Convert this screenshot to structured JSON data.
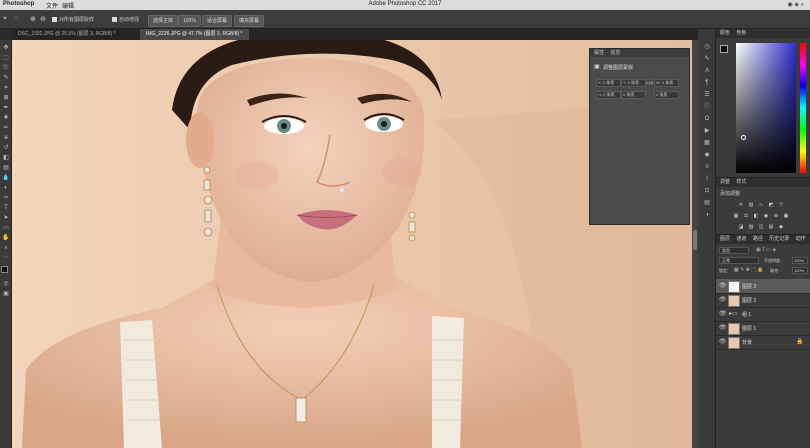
{
  "app": {
    "title": "Adobe Photoshop CC 2017",
    "menu_app": "Photoshop",
    "menu_file": "文件",
    "menu_edit": "编辑"
  },
  "options": {
    "sample_all_layers": "对所有图层取样",
    "auto_enhance": "自动增强",
    "select_subject": "选择主体",
    "select_and_mask": "选择并遮住...",
    "zoom": "100%",
    "fit_screen": "适合屏幕",
    "fill_screen": "填充屏幕"
  },
  "tabs": [
    {
      "label": "DSC_1592.JPG @ 25.5% (图层 3, RGB/8) *"
    },
    {
      "label": "IMG_2226.JPG @ 47.7% (图层 3, RGB/8) *"
    }
  ],
  "properties": {
    "tabs": [
      "属性",
      "信息"
    ],
    "title": "调整图层蒙版",
    "fields": [
      "X: 0 像素",
      "Y: 0 像素",
      "W: 0 像素",
      "H: 0 像素",
      "0 像素",
      "0 像素"
    ],
    "link": "GO"
  },
  "color_panel": {
    "tabs": [
      "颜色",
      "色板"
    ]
  },
  "adjustments": {
    "tabs": [
      "调整",
      "样式"
    ],
    "hint": "添加调整"
  },
  "layers": {
    "tabs": [
      "图层",
      "通道",
      "路径",
      "历史记录",
      "动作"
    ],
    "kind": "类型",
    "blend_mode": "正常",
    "opacity_label": "不透明度:",
    "opacity_value": "100%",
    "lock_label": "锁定:",
    "fill_label": "填充:",
    "fill_value": "100%",
    "items": [
      {
        "name": "图层 3"
      },
      {
        "name": "图层 2"
      },
      {
        "name": "组 1"
      },
      {
        "name": "图层 1"
      },
      {
        "name": "背景"
      }
    ]
  },
  "colors": {
    "canvas_bg": "#e9c9ad",
    "panel_bg": "#3b3b3b",
    "accent": "#2f6fd1"
  }
}
